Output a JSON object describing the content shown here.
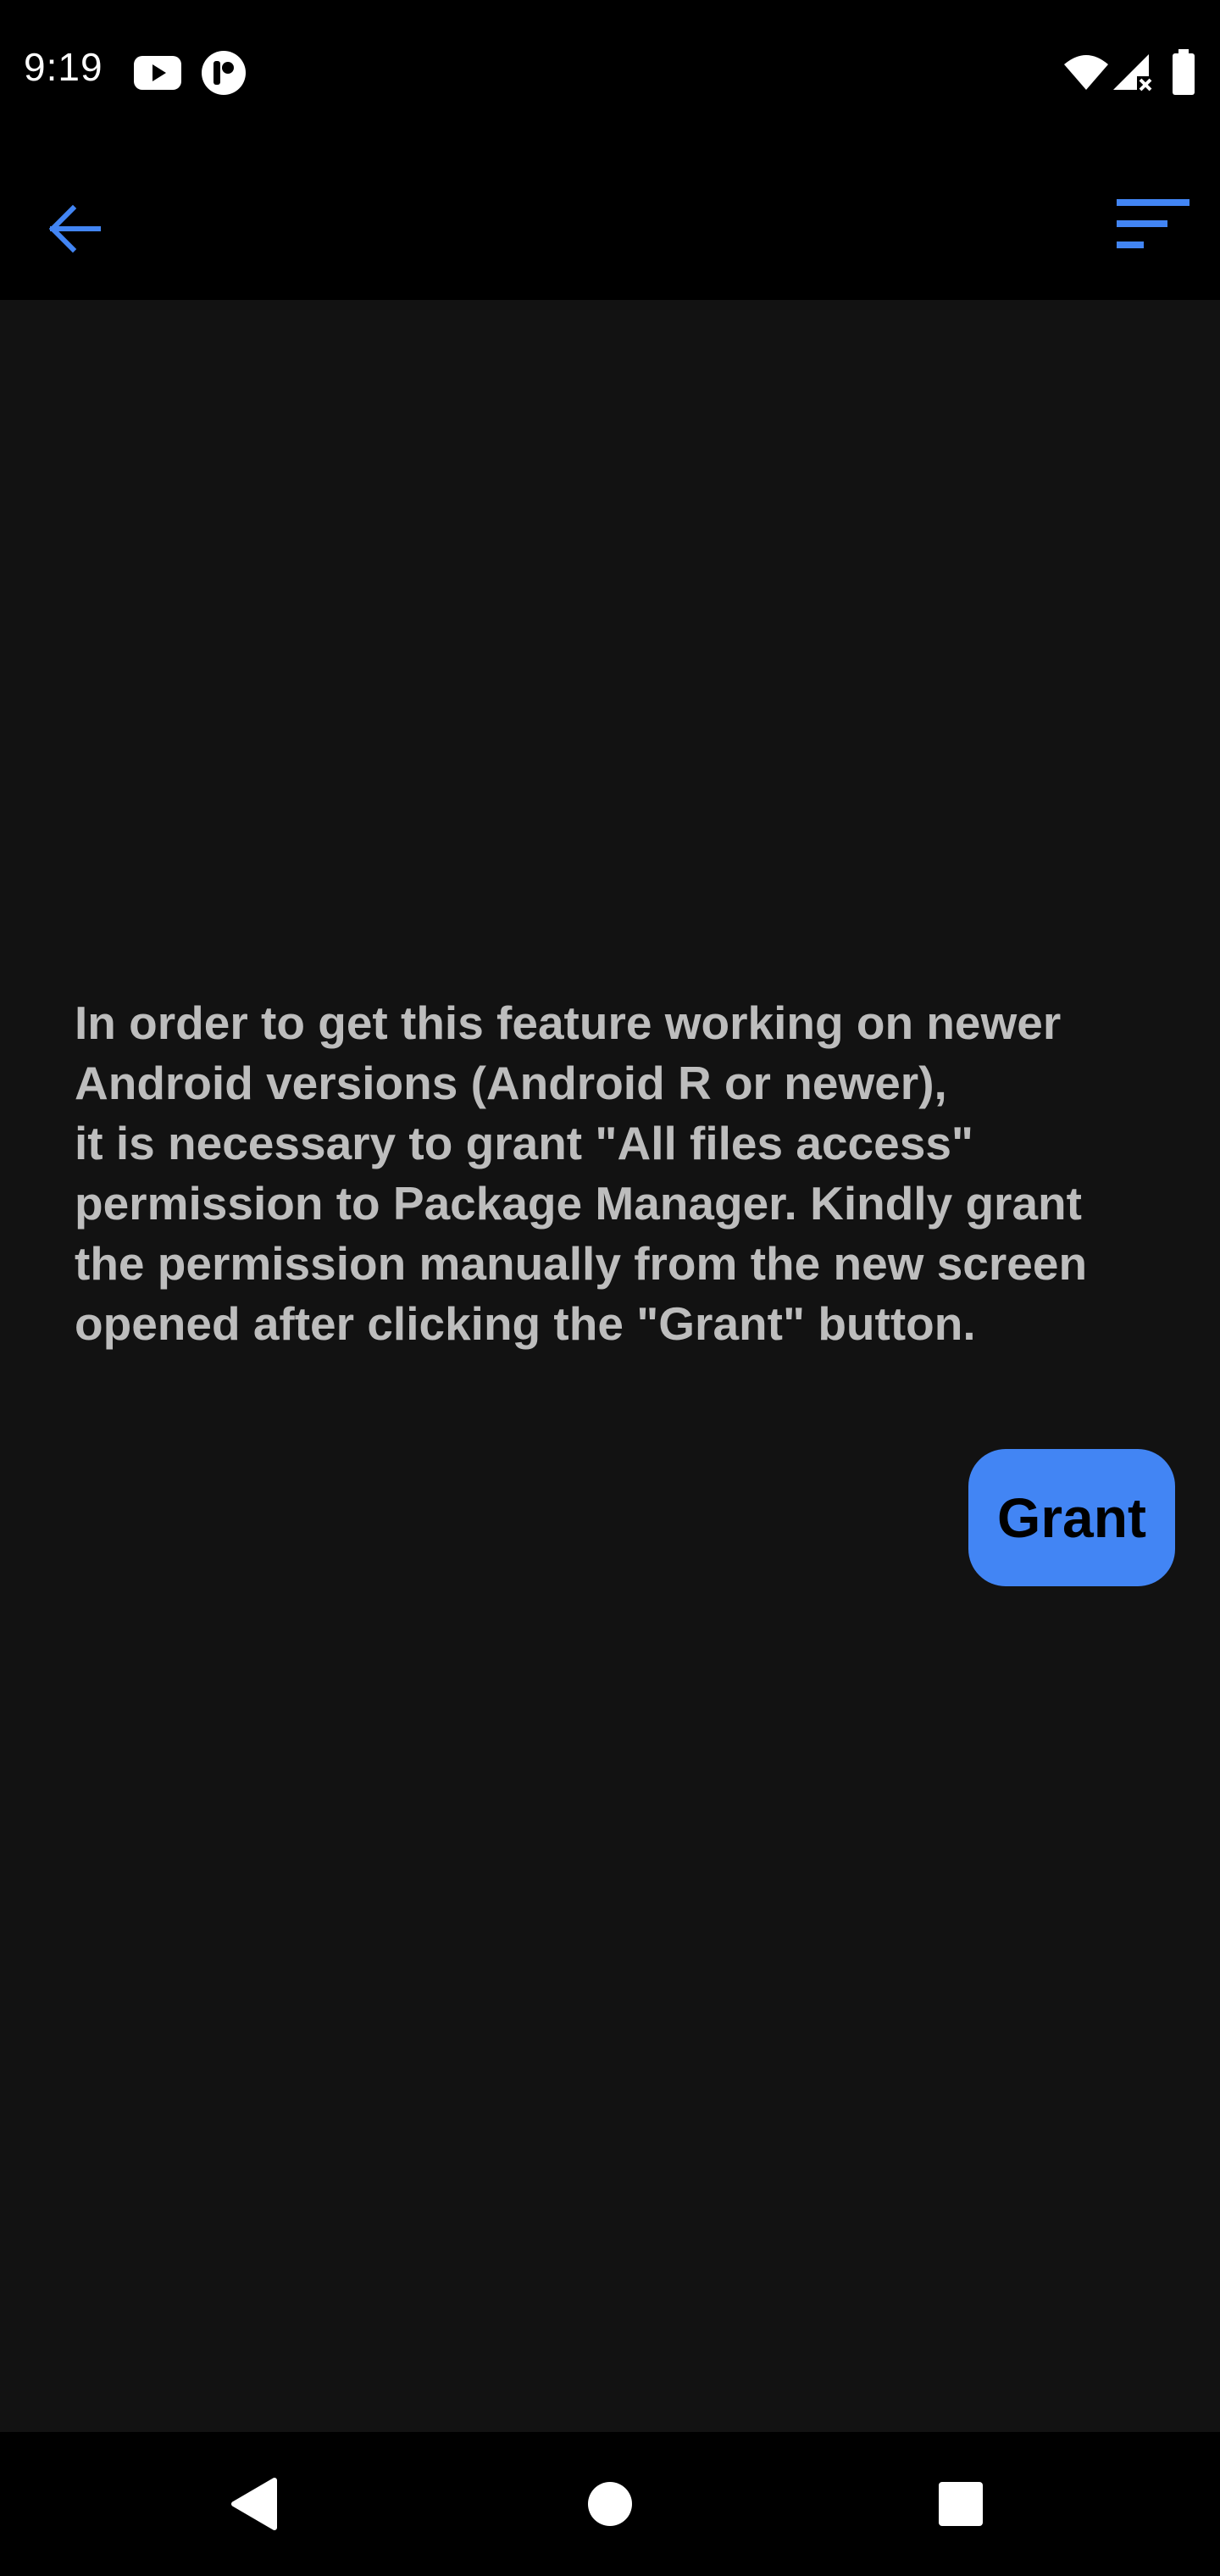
{
  "status_bar": {
    "time": "9:19",
    "icons": [
      "youtube-icon",
      "app-notification-icon",
      "wifi-icon",
      "cell-signal-no-data-icon",
      "battery-icon"
    ]
  },
  "app_bar": {
    "back_icon": "arrow-back-icon",
    "sort_icon": "sort-icon",
    "accent_color": "#4285f4"
  },
  "content": {
    "message": "In order to get this feature working on newer\nAndroid versions (Android R or newer),\nit is necessary to grant \"All files access\"\npermission to Package Manager. Kindly grant\nthe permission manually from the new screen\nopened after clicking the \"Grant\" button.",
    "grant_label": "Grant"
  },
  "nav_bar": {
    "icons": [
      "back-triangle-icon",
      "home-circle-icon",
      "recents-square-icon"
    ]
  },
  "colors": {
    "background": "#121212",
    "bars": "#000000",
    "text": "#bdbdbd",
    "accent": "#4285f4"
  }
}
